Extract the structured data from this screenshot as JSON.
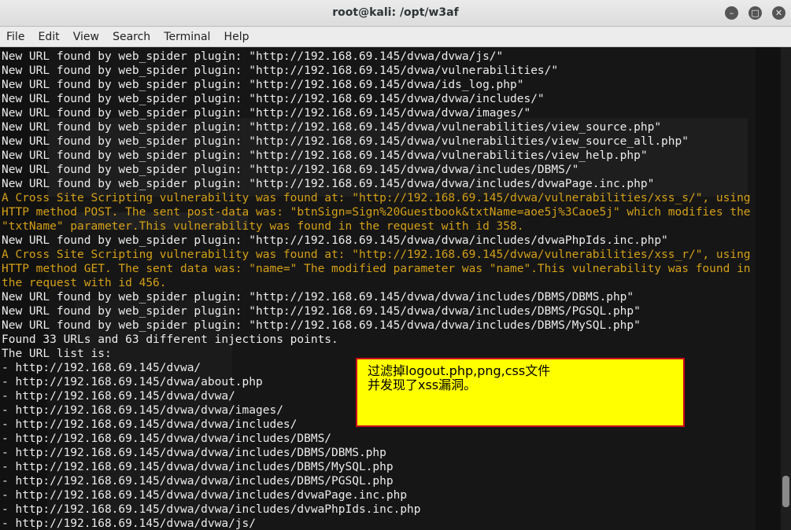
{
  "window": {
    "title": "root@kali: /opt/w3af",
    "min_icon": "–",
    "max_icon": "□",
    "close_icon": "✕"
  },
  "menu": [
    "File",
    "Edit",
    "View",
    "Search",
    "Terminal",
    "Help"
  ],
  "terminal": {
    "lines": [
      {
        "text": "New URL found by web_spider plugin: \"http://192.168.69.145/dvwa/dvwa/js/\"",
        "kind": "normal"
      },
      {
        "text": "New URL found by web_spider plugin: \"http://192.168.69.145/dvwa/vulnerabilities/\"",
        "kind": "normal"
      },
      {
        "text": "New URL found by web_spider plugin: \"http://192.168.69.145/dvwa/ids_log.php\"",
        "kind": "normal"
      },
      {
        "text": "New URL found by web_spider plugin: \"http://192.168.69.145/dvwa/dvwa/includes/\"",
        "kind": "normal"
      },
      {
        "text": "New URL found by web_spider plugin: \"http://192.168.69.145/dvwa/dvwa/images/\"",
        "kind": "normal"
      },
      {
        "text": "New URL found by web_spider plugin: \"http://192.168.69.145/dvwa/vulnerabilities/view_source.php\"",
        "kind": "normal"
      },
      {
        "text": "New URL found by web_spider plugin: \"http://192.168.69.145/dvwa/vulnerabilities/view_source_all.php\"",
        "kind": "normal"
      },
      {
        "text": "New URL found by web_spider plugin: \"http://192.168.69.145/dvwa/vulnerabilities/view_help.php\"",
        "kind": "normal"
      },
      {
        "text": "New URL found by web_spider plugin: \"http://192.168.69.145/dvwa/dvwa/includes/DBMS/\"",
        "kind": "normal"
      },
      {
        "text": "New URL found by web_spider plugin: \"http://192.168.69.145/dvwa/dvwa/includes/dvwaPage.inc.php\"",
        "kind": "normal"
      },
      {
        "text": "A Cross Site Scripting vulnerability was found at: \"http://192.168.69.145/dvwa/vulnerabilities/xss_s/\", using",
        "kind": "warn"
      },
      {
        "text": "HTTP method POST. The sent post-data was: \"btnSign=Sign%20Guestbook&txtName=aoe5j%3Caoe5j\" which modifies the",
        "kind": "warn"
      },
      {
        "text": "\"txtName\" parameter.This vulnerability was found in the request with id 358.",
        "kind": "warn"
      },
      {
        "text": "New URL found by web_spider plugin: \"http://192.168.69.145/dvwa/dvwa/includes/dvwaPhpIds.inc.php\"",
        "kind": "normal"
      },
      {
        "text": "A Cross Site Scripting vulnerability was found at: \"http://192.168.69.145/dvwa/vulnerabilities/xss_r/\", using",
        "kind": "warn"
      },
      {
        "text": "HTTP method GET. The sent data was: \"name=\" The modified parameter was \"name\".This vulnerability was found in",
        "kind": "warn"
      },
      {
        "text": "the request with id 456.",
        "kind": "warn"
      },
      {
        "text": "New URL found by web_spider plugin: \"http://192.168.69.145/dvwa/dvwa/includes/DBMS/DBMS.php\"",
        "kind": "normal"
      },
      {
        "text": "New URL found by web_spider plugin: \"http://192.168.69.145/dvwa/dvwa/includes/DBMS/PGSQL.php\"",
        "kind": "normal"
      },
      {
        "text": "New URL found by web_spider plugin: \"http://192.168.69.145/dvwa/dvwa/includes/DBMS/MySQL.php\"",
        "kind": "normal"
      },
      {
        "text": "Found 33 URLs and 63 different injections points.",
        "kind": "normal"
      },
      {
        "text": "The URL list is:",
        "kind": "normal"
      },
      {
        "text": "- http://192.168.69.145/dvwa/",
        "kind": "normal"
      },
      {
        "text": "- http://192.168.69.145/dvwa/about.php",
        "kind": "normal"
      },
      {
        "text": "- http://192.168.69.145/dvwa/dvwa/",
        "kind": "normal"
      },
      {
        "text": "- http://192.168.69.145/dvwa/dvwa/images/",
        "kind": "normal"
      },
      {
        "text": "- http://192.168.69.145/dvwa/dvwa/includes/",
        "kind": "normal"
      },
      {
        "text": "- http://192.168.69.145/dvwa/dvwa/includes/DBMS/",
        "kind": "normal"
      },
      {
        "text": "- http://192.168.69.145/dvwa/dvwa/includes/DBMS/DBMS.php",
        "kind": "normal"
      },
      {
        "text": "- http://192.168.69.145/dvwa/dvwa/includes/DBMS/MySQL.php",
        "kind": "normal"
      },
      {
        "text": "- http://192.168.69.145/dvwa/dvwa/includes/DBMS/PGSQL.php",
        "kind": "normal"
      },
      {
        "text": "- http://192.168.69.145/dvwa/dvwa/includes/dvwaPage.inc.php",
        "kind": "normal"
      },
      {
        "text": "- http://192.168.69.145/dvwa/dvwa/includes/dvwaPhpIds.inc.php",
        "kind": "normal"
      },
      {
        "text": "- http://192.168.69.145/dvwa/dvwa/js/",
        "kind": "normal"
      }
    ]
  },
  "annotation": {
    "line1": "过滤掉logout.php,png,css文件",
    "line2": "并发现了xss漏洞。"
  },
  "colors": {
    "normal_text": "#ececec",
    "warning_text": "#d4a017",
    "note_background": "#ffff00",
    "note_border": "#c8001e"
  }
}
